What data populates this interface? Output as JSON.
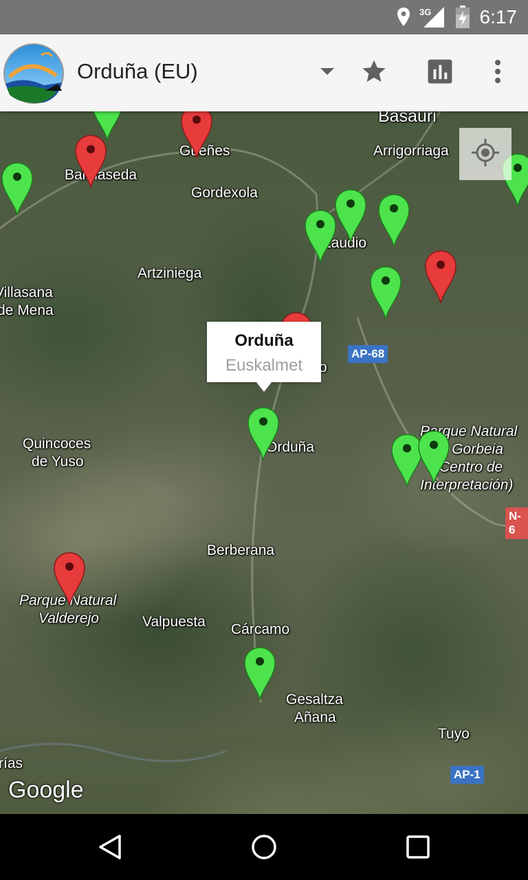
{
  "status_bar": {
    "network": "3G",
    "time": "6:17",
    "icons": [
      "location-icon",
      "signal-icon",
      "battery-icon"
    ]
  },
  "toolbar": {
    "title": "Orduña (EU)",
    "icons": [
      "dropdown-arrow-icon",
      "star-icon",
      "chart-icon",
      "overflow-menu-icon"
    ]
  },
  "map": {
    "places": [
      "Basauri",
      "Arrigorriaga",
      "Güeñes",
      "Balmaseda",
      "Gordexola",
      "Laudio",
      "Artziniega",
      "Villasana de Mena",
      "Amurrio",
      "Orduña",
      "Quincoces de Yuso",
      "Parque Natural de Gorbeia (Centro de Interpretación)",
      "Berberana",
      "Parque Natural Valderejo",
      "Valpuesta",
      "Cárcamo",
      "Gesaltza Añana",
      "Tuyo",
      "Arías"
    ],
    "labels": {
      "basauri": "Basauri",
      "arrigorriaga": "Arrigorriaga",
      "guenes": "Güeñes",
      "balmaseda": "Balmaseda",
      "gordexola": "Gordexola",
      "laudio": "Laudio",
      "artziniega": "Artziniega",
      "villasana_1": "Villasana",
      "villasana_2": "de Mena",
      "amurrio": "o",
      "orduna": "Orduña",
      "quincoces_1": "Quincoces",
      "quincoces_2": "de Yuso",
      "gorbeia_1": "Parque Natural",
      "gorbeia_2": "de Gorbeia",
      "gorbeia_3": "(Centro de",
      "gorbeia_4": "Interpretación)",
      "berberana": "Berberana",
      "valderejo_1": "Parque Natural",
      "valderejo_2": "Valderejo",
      "valpuesta": "Valpuesta",
      "carcamo": "Cárcamo",
      "gesaltza_1": "Gesaltza",
      "gesaltza_2": "Añana",
      "tuyo": "Tuyo",
      "arias": "rías"
    },
    "roads": {
      "ap68": "AP-68",
      "n6": "N-6",
      "ap1": "AP-1"
    },
    "road_colors": {
      "motorway": "#3a73c4",
      "national": "#d9534f"
    },
    "marker_colors": {
      "green": "#4ce34c",
      "red": "#e83b3b"
    },
    "info_window": {
      "title": "Orduña",
      "subtitle": "Euskalmet"
    },
    "attribution": "Google"
  },
  "nav_bar": {
    "buttons": [
      "back-icon",
      "home-icon",
      "recents-icon"
    ]
  }
}
